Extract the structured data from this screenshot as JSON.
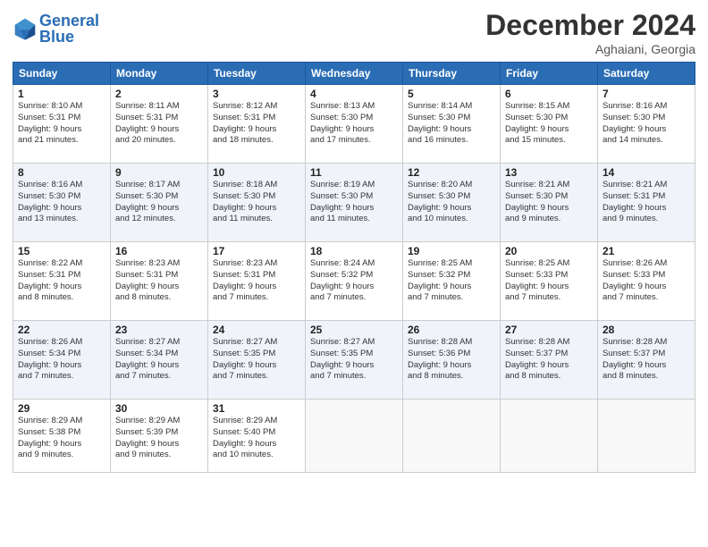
{
  "header": {
    "logo_text_general": "General",
    "logo_text_blue": "Blue",
    "month": "December 2024",
    "location": "Aghaiani, Georgia"
  },
  "weekdays": [
    "Sunday",
    "Monday",
    "Tuesday",
    "Wednesday",
    "Thursday",
    "Friday",
    "Saturday"
  ],
  "weeks": [
    [
      {
        "day": 1,
        "info": "Sunrise: 8:10 AM\nSunset: 5:31 PM\nDaylight: 9 hours\nand 21 minutes."
      },
      {
        "day": 2,
        "info": "Sunrise: 8:11 AM\nSunset: 5:31 PM\nDaylight: 9 hours\nand 20 minutes."
      },
      {
        "day": 3,
        "info": "Sunrise: 8:12 AM\nSunset: 5:31 PM\nDaylight: 9 hours\nand 18 minutes."
      },
      {
        "day": 4,
        "info": "Sunrise: 8:13 AM\nSunset: 5:30 PM\nDaylight: 9 hours\nand 17 minutes."
      },
      {
        "day": 5,
        "info": "Sunrise: 8:14 AM\nSunset: 5:30 PM\nDaylight: 9 hours\nand 16 minutes."
      },
      {
        "day": 6,
        "info": "Sunrise: 8:15 AM\nSunset: 5:30 PM\nDaylight: 9 hours\nand 15 minutes."
      },
      {
        "day": 7,
        "info": "Sunrise: 8:16 AM\nSunset: 5:30 PM\nDaylight: 9 hours\nand 14 minutes."
      }
    ],
    [
      {
        "day": 8,
        "info": "Sunrise: 8:16 AM\nSunset: 5:30 PM\nDaylight: 9 hours\nand 13 minutes."
      },
      {
        "day": 9,
        "info": "Sunrise: 8:17 AM\nSunset: 5:30 PM\nDaylight: 9 hours\nand 12 minutes."
      },
      {
        "day": 10,
        "info": "Sunrise: 8:18 AM\nSunset: 5:30 PM\nDaylight: 9 hours\nand 11 minutes."
      },
      {
        "day": 11,
        "info": "Sunrise: 8:19 AM\nSunset: 5:30 PM\nDaylight: 9 hours\nand 11 minutes."
      },
      {
        "day": 12,
        "info": "Sunrise: 8:20 AM\nSunset: 5:30 PM\nDaylight: 9 hours\nand 10 minutes."
      },
      {
        "day": 13,
        "info": "Sunrise: 8:21 AM\nSunset: 5:30 PM\nDaylight: 9 hours\nand 9 minutes."
      },
      {
        "day": 14,
        "info": "Sunrise: 8:21 AM\nSunset: 5:31 PM\nDaylight: 9 hours\nand 9 minutes."
      }
    ],
    [
      {
        "day": 15,
        "info": "Sunrise: 8:22 AM\nSunset: 5:31 PM\nDaylight: 9 hours\nand 8 minutes."
      },
      {
        "day": 16,
        "info": "Sunrise: 8:23 AM\nSunset: 5:31 PM\nDaylight: 9 hours\nand 8 minutes."
      },
      {
        "day": 17,
        "info": "Sunrise: 8:23 AM\nSunset: 5:31 PM\nDaylight: 9 hours\nand 7 minutes."
      },
      {
        "day": 18,
        "info": "Sunrise: 8:24 AM\nSunset: 5:32 PM\nDaylight: 9 hours\nand 7 minutes."
      },
      {
        "day": 19,
        "info": "Sunrise: 8:25 AM\nSunset: 5:32 PM\nDaylight: 9 hours\nand 7 minutes."
      },
      {
        "day": 20,
        "info": "Sunrise: 8:25 AM\nSunset: 5:33 PM\nDaylight: 9 hours\nand 7 minutes."
      },
      {
        "day": 21,
        "info": "Sunrise: 8:26 AM\nSunset: 5:33 PM\nDaylight: 9 hours\nand 7 minutes."
      }
    ],
    [
      {
        "day": 22,
        "info": "Sunrise: 8:26 AM\nSunset: 5:34 PM\nDaylight: 9 hours\nand 7 minutes."
      },
      {
        "day": 23,
        "info": "Sunrise: 8:27 AM\nSunset: 5:34 PM\nDaylight: 9 hours\nand 7 minutes."
      },
      {
        "day": 24,
        "info": "Sunrise: 8:27 AM\nSunset: 5:35 PM\nDaylight: 9 hours\nand 7 minutes."
      },
      {
        "day": 25,
        "info": "Sunrise: 8:27 AM\nSunset: 5:35 PM\nDaylight: 9 hours\nand 7 minutes."
      },
      {
        "day": 26,
        "info": "Sunrise: 8:28 AM\nSunset: 5:36 PM\nDaylight: 9 hours\nand 8 minutes."
      },
      {
        "day": 27,
        "info": "Sunrise: 8:28 AM\nSunset: 5:37 PM\nDaylight: 9 hours\nand 8 minutes."
      },
      {
        "day": 28,
        "info": "Sunrise: 8:28 AM\nSunset: 5:37 PM\nDaylight: 9 hours\nand 8 minutes."
      }
    ],
    [
      {
        "day": 29,
        "info": "Sunrise: 8:29 AM\nSunset: 5:38 PM\nDaylight: 9 hours\nand 9 minutes."
      },
      {
        "day": 30,
        "info": "Sunrise: 8:29 AM\nSunset: 5:39 PM\nDaylight: 9 hours\nand 9 minutes."
      },
      {
        "day": 31,
        "info": "Sunrise: 8:29 AM\nSunset: 5:40 PM\nDaylight: 9 hours\nand 10 minutes."
      },
      null,
      null,
      null,
      null
    ]
  ]
}
